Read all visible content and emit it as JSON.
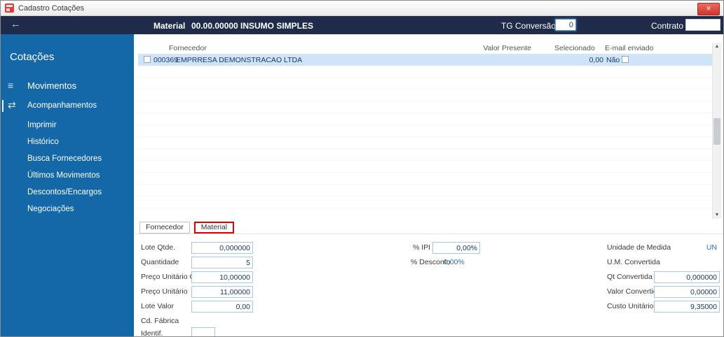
{
  "colors": {
    "header_bg": "#202b4a",
    "sidebar_bg": "#1468a8",
    "row_highlight": "#cfe4f8",
    "focus_red": "#e00000",
    "value_navy": "#17375e",
    "value_blue": "#2e6fb0",
    "close_red": "#cf332c"
  },
  "icons": {
    "close": "✕",
    "back": "←",
    "menu": "≡",
    "swap": "⇄",
    "scroll_up": "▲",
    "scroll_down": "▼"
  },
  "titlebar": {
    "title": "Cadastro Cotações"
  },
  "header": {
    "material_label": "Material",
    "material_code": "00.00.00000",
    "material_desc": "INSUMO SIMPLES",
    "tg_label": "TG Conversão",
    "tg_value": "0",
    "contrato_label": "Contrato",
    "contrato_value": ""
  },
  "sidebar": {
    "title": "Cotações",
    "items": [
      {
        "label": "Movimentos"
      },
      {
        "label": "Acompanhamentos"
      },
      {
        "label": "Imprimir"
      },
      {
        "label": "Histórico"
      },
      {
        "label": "Busca Fornecedores"
      },
      {
        "label": "Últimos Movimentos"
      },
      {
        "label": "Descontos/Encargos"
      },
      {
        "label": "Negociações"
      }
    ]
  },
  "grid": {
    "columns": [
      "Fornecedor",
      "Valor Presente",
      "Selecionado",
      "E-mail enviado"
    ],
    "rows": [
      {
        "code": "000369",
        "fornecedor": "EMPRRESA DEMONSTRACAO LTDA",
        "valor_presente": "0,00",
        "selecionado": "Não",
        "email_enviado": false
      }
    ]
  },
  "tabs": {
    "items": [
      {
        "label": "Fornecedor",
        "focused": false
      },
      {
        "label": "Material",
        "focused": true
      }
    ]
  },
  "form": {
    "left": [
      {
        "label": "Lote Qtde.",
        "value": "0,000000"
      },
      {
        "label": "Quantidade",
        "value": "5"
      },
      {
        "label": "Preço Unitário Origem",
        "value": "10,00000"
      },
      {
        "label": "Preço Unitário",
        "value": "11,00000"
      },
      {
        "label": "Lote Valor",
        "value": "0,00"
      },
      {
        "label": "Cd. Fábrica"
      },
      {
        "label": "Identif.",
        "value": ""
      }
    ],
    "middle": [
      {
        "label": "% IPI",
        "value": "0,00%"
      },
      {
        "label": "% Desconto",
        "value": "0,00%"
      }
    ],
    "right": [
      {
        "label": "Unidade de Medida",
        "value": "UN"
      },
      {
        "label": "U.M. Convertida",
        "value": ""
      },
      {
        "label": "Qt Convertida",
        "value": "0,000000"
      },
      {
        "label": "Valor Convertido",
        "value": "0,00000"
      },
      {
        "label": "Custo Unitário",
        "value": "9,35000"
      }
    ]
  }
}
